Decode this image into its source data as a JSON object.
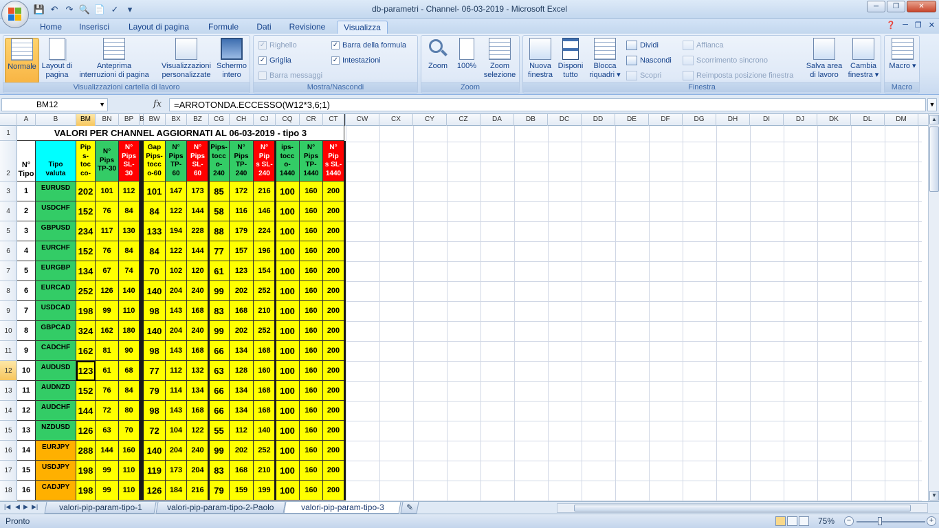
{
  "window": {
    "title": "db-parametri - Channel- 06-03-2019 - Microsoft Excel"
  },
  "ribbon": {
    "tabs": [
      "Home",
      "Inserisci",
      "Layout di pagina",
      "Formule",
      "Dati",
      "Revisione",
      "Visualizza"
    ],
    "active_tab": "Visualizza",
    "groups": {
      "views": {
        "label": "Visualizzazioni cartella di lavoro",
        "normale": "Normale",
        "layout1": "Layout di",
        "layout2": "pagina",
        "anteprima1": "Anteprima",
        "anteprima2": "interruzioni di pagina",
        "pers1": "Visualizzazioni",
        "pers2": "personalizzate",
        "schermo1": "Schermo",
        "schermo2": "intero"
      },
      "show": {
        "label": "Mostra/Nascondi",
        "righello": "Righello",
        "barra_formula": "Barra della formula",
        "griglia": "Griglia",
        "intestazioni": "Intestazioni",
        "barra_messaggi": "Barra messaggi"
      },
      "zoom": {
        "label": "Zoom",
        "zoom": "Zoom",
        "cento": "100%",
        "sel1": "Zoom",
        "sel2": "selezione"
      },
      "window": {
        "label": "Finestra",
        "nuova1": "Nuova",
        "nuova2": "finestra",
        "disp1": "Disponi",
        "disp2": "tutto",
        "blocca1": "Blocca",
        "blocca2": "riquadri",
        "dividi": "Dividi",
        "nascondi": "Nascondi",
        "scopri": "Scopri",
        "affianca": "Affianca",
        "scorrimento": "Scorrimento sincrono",
        "reimposta": "Reimposta posizione finestra",
        "salva1": "Salva area",
        "salva2": "di lavoro",
        "cambia1": "Cambia",
        "cambia2": "finestra"
      },
      "macro": {
        "label": "Macro",
        "macro": "Macro"
      }
    }
  },
  "formula_bar": {
    "name_box": "BM12",
    "fx": "fx",
    "formula": "=ARROTONDA.ECCESSO(W12*3,6;1)"
  },
  "columns": {
    "frozen": [
      "A",
      "B",
      "BM",
      "BN",
      "BP",
      "B",
      "BW",
      "BX",
      "BZ",
      "CG",
      "CH",
      "CJ",
      "CQ",
      "CR",
      "CT"
    ],
    "scroll": [
      "CW",
      "CX",
      "CY",
      "CZ",
      "DA",
      "DB",
      "DC",
      "DD",
      "DE",
      "DF",
      "DG",
      "DH",
      "DI",
      "DJ",
      "DK",
      "DL",
      "DM"
    ]
  },
  "sheet": {
    "title": "VALORI PER CHANNEL AGGIORNATI AL 06-03-2019 - tipo 3",
    "headers": {
      "tipo": [
        "N°",
        "Tipo"
      ],
      "valuta": [
        "Tipo",
        "valuta"
      ],
      "h": [
        [
          "Pip",
          "s-",
          "toc",
          "co-"
        ],
        [
          "N°",
          "Pips",
          "TP-30"
        ],
        [
          "N°",
          "Pips",
          "SL-",
          "30"
        ],
        [
          "Gap",
          "Pips-",
          "tocc",
          "o-60"
        ],
        [
          "N°",
          "Pips",
          "TP-",
          "60"
        ],
        [
          "N°",
          "Pips",
          "SL-",
          "60"
        ],
        [
          "Pips-",
          "tocc",
          "o-",
          "240"
        ],
        [
          "N°",
          "Pips",
          "TP-",
          "240"
        ],
        [
          "N°",
          "Pip",
          "s SL-",
          "240"
        ],
        [
          "ips-",
          "tocc",
          "o-",
          "1440"
        ],
        [
          "N°",
          "Pips",
          "TP-",
          "1440"
        ],
        [
          "N°",
          "Pip",
          "s SL-",
          "1440"
        ]
      ]
    },
    "rows": [
      {
        "n": "1",
        "sym": "EURUSD",
        "v": [
          "202",
          "101",
          "112",
          "101",
          "147",
          "173",
          "85",
          "172",
          "216",
          "100",
          "160",
          "200"
        ]
      },
      {
        "n": "2",
        "sym": "USDCHF",
        "v": [
          "152",
          "76",
          "84",
          "84",
          "122",
          "144",
          "58",
          "116",
          "146",
          "100",
          "160",
          "200"
        ]
      },
      {
        "n": "3",
        "sym": "GBPUSD",
        "v": [
          "234",
          "117",
          "130",
          "133",
          "194",
          "228",
          "88",
          "179",
          "224",
          "100",
          "160",
          "200"
        ]
      },
      {
        "n": "4",
        "sym": "EURCHF",
        "v": [
          "152",
          "76",
          "84",
          "84",
          "122",
          "144",
          "77",
          "157",
          "196",
          "100",
          "160",
          "200"
        ]
      },
      {
        "n": "5",
        "sym": "EURGBP",
        "v": [
          "134",
          "67",
          "74",
          "70",
          "102",
          "120",
          "61",
          "123",
          "154",
          "100",
          "160",
          "200"
        ]
      },
      {
        "n": "6",
        "sym": "EURCAD",
        "v": [
          "252",
          "126",
          "140",
          "140",
          "204",
          "240",
          "99",
          "202",
          "252",
          "100",
          "160",
          "200"
        ]
      },
      {
        "n": "7",
        "sym": "USDCAD",
        "v": [
          "198",
          "99",
          "110",
          "98",
          "143",
          "168",
          "83",
          "168",
          "210",
          "100",
          "160",
          "200"
        ]
      },
      {
        "n": "8",
        "sym": "GBPCAD",
        "v": [
          "324",
          "162",
          "180",
          "140",
          "204",
          "240",
          "99",
          "202",
          "252",
          "100",
          "160",
          "200"
        ]
      },
      {
        "n": "9",
        "sym": "CADCHF",
        "v": [
          "162",
          "81",
          "90",
          "98",
          "143",
          "168",
          "66",
          "134",
          "168",
          "100",
          "160",
          "200"
        ]
      },
      {
        "n": "10",
        "sym": "AUDUSD",
        "v": [
          "123",
          "61",
          "68",
          "77",
          "112",
          "132",
          "63",
          "128",
          "160",
          "100",
          "160",
          "200"
        ]
      },
      {
        "n": "11",
        "sym": "AUDNZD",
        "v": [
          "152",
          "76",
          "84",
          "79",
          "114",
          "134",
          "66",
          "134",
          "168",
          "100",
          "160",
          "200"
        ]
      },
      {
        "n": "12",
        "sym": "AUDCHF",
        "v": [
          "144",
          "72",
          "80",
          "98",
          "143",
          "168",
          "66",
          "134",
          "168",
          "100",
          "160",
          "200"
        ]
      },
      {
        "n": "13",
        "sym": "NZDUSD",
        "v": [
          "126",
          "63",
          "70",
          "72",
          "104",
          "122",
          "55",
          "112",
          "140",
          "100",
          "160",
          "200"
        ]
      },
      {
        "n": "14",
        "sym": "EURJPY",
        "v": [
          "288",
          "144",
          "160",
          "140",
          "204",
          "240",
          "99",
          "202",
          "252",
          "100",
          "160",
          "200"
        ]
      },
      {
        "n": "15",
        "sym": "USDJPY",
        "v": [
          "198",
          "99",
          "110",
          "119",
          "173",
          "204",
          "83",
          "168",
          "210",
          "100",
          "160",
          "200"
        ]
      },
      {
        "n": "16",
        "sym": "CADJPY",
        "v": [
          "198",
          "99",
          "110",
          "126",
          "184",
          "216",
          "79",
          "159",
          "199",
          "100",
          "160",
          "200"
        ]
      }
    ],
    "row_numbers": [
      "1",
      "2",
      "3",
      "4",
      "5",
      "6",
      "7",
      "8",
      "9",
      "10",
      "11",
      "12",
      "13",
      "14",
      "15",
      "16",
      "17",
      "18"
    ],
    "active_row": "12",
    "active_col": "BM"
  },
  "sheet_tabs": [
    "valori-pip-param-tipo-1",
    "valori-pip-param-tipo-2-Paolo",
    "valori-pip-param-tipo-3"
  ],
  "active_sheet_tab": "valori-pip-param-tipo-3",
  "status": {
    "text": "Pronto",
    "zoom": "75%"
  },
  "colors": {
    "green": "#33cc66",
    "yellow": "#ffff00",
    "red": "#ff0000",
    "cyan": "#00ffff",
    "orange": "#ffb000",
    "active_header": "#f7c65e"
  }
}
